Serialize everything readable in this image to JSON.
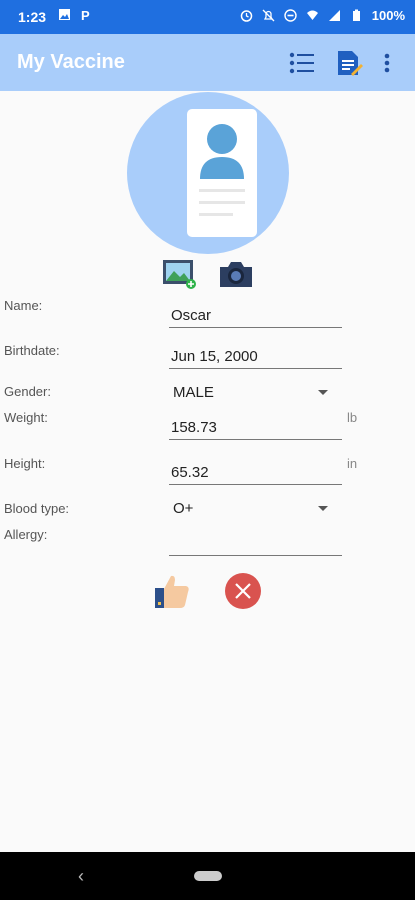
{
  "status_bar": {
    "time": "1:23",
    "battery": "100%"
  },
  "app_bar": {
    "title": "My Vaccine"
  },
  "form": {
    "name_label": "Name:",
    "name_value": "Oscar",
    "birthdate_label": "Birthdate:",
    "birthdate_value": "Jun 15, 2000",
    "gender_label": "Gender:",
    "gender_value": "MALE",
    "weight_label": "Weight:",
    "weight_value": "158.73",
    "weight_unit": "lb",
    "height_label": "Height:",
    "height_value": "65.32",
    "height_unit": "in",
    "blood_type_label": "Blood type:",
    "blood_type_value": "O+",
    "allergy_label": "Allergy:",
    "allergy_value": ""
  },
  "colors": {
    "status_bar": "#1f6fe0",
    "app_bar": "#a9cdfa",
    "cancel_red": "#d9534f"
  }
}
